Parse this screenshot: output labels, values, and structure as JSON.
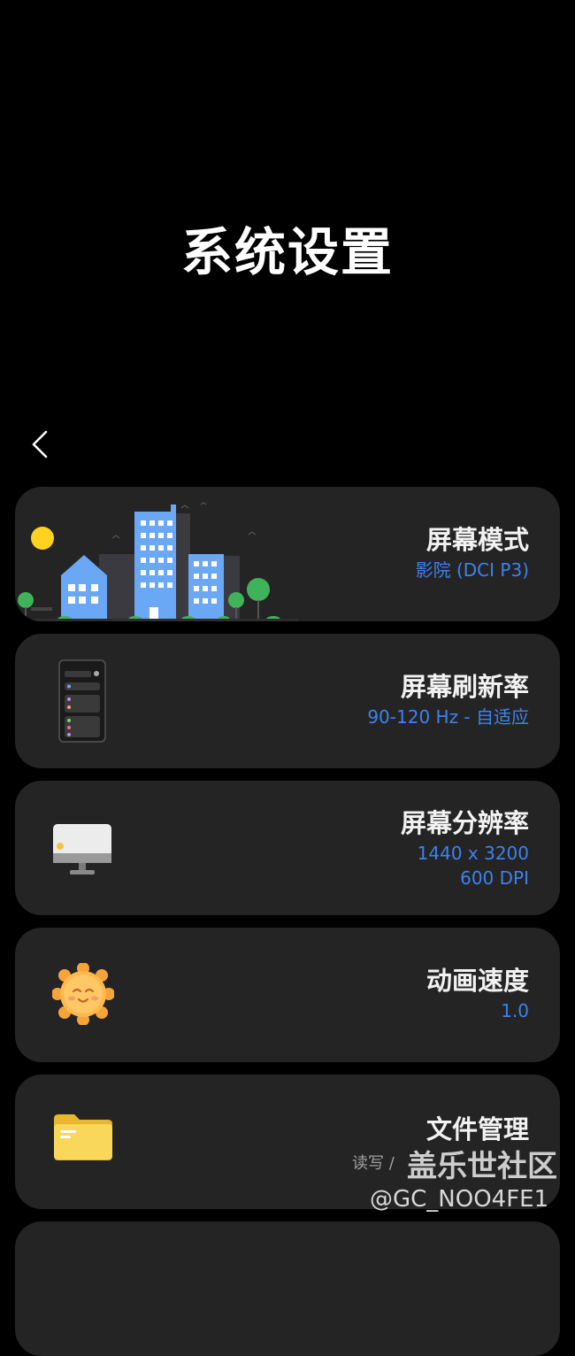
{
  "page": {
    "title": "系统设置"
  },
  "nav": {
    "back_icon": "chevron-left-icon"
  },
  "settings": [
    {
      "title": "屏幕模式",
      "subtitle": "影院 (DCI P3)",
      "icon": "city-illustration-icon"
    },
    {
      "title": "屏幕刷新率",
      "subtitle": "90-120 Hz - 自适应",
      "icon": "phone-screen-icon"
    },
    {
      "title": "屏幕分辨率",
      "subtitle_line1": "1440 x 3200",
      "subtitle_line2": "600 DPI",
      "icon": "monitor-icon"
    },
    {
      "title": "动画速度",
      "subtitle": "1.0",
      "icon": "sun-face-icon"
    },
    {
      "title": "文件管理",
      "icon": "folder-icon"
    }
  ],
  "watermark": {
    "small_text": "读写 /",
    "brand": "盖乐世社区",
    "handle": "@GC_NOO4FE1"
  },
  "colors": {
    "background": "#000000",
    "card": "#242424",
    "accent": "#3d82f0",
    "title_text": "#f2f2f2"
  }
}
